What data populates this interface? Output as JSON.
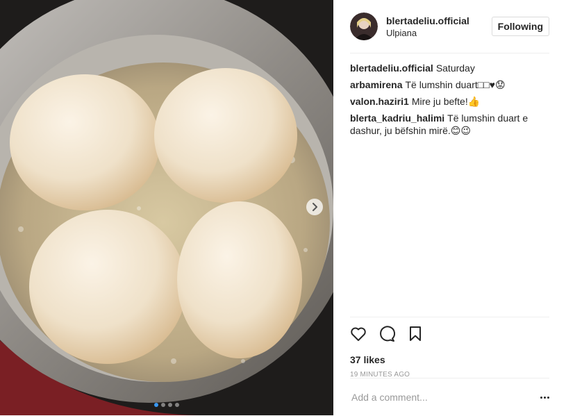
{
  "post": {
    "username": "blertadeliu.official",
    "location": "Ulpiana",
    "follow_label": "Following",
    "caption": "Saturday",
    "comments": [
      {
        "user": "arbamirena",
        "text": "Të lumshin duart□□♥😟"
      },
      {
        "user": "valon.haziri1",
        "text": "Mire ju befte!👍"
      },
      {
        "user": "blerta_kadriu_halimi",
        "text": "Të lumshin duart e dashur, ju bëfshin mirë.😊😉"
      }
    ],
    "likes": "37 likes",
    "time": "19 MINUTES AGO",
    "add_comment_placeholder": "Add a comment..."
  },
  "carousel": {
    "current": 1,
    "total": 4
  },
  "icons": {
    "like": "heart-outline-icon",
    "comment": "speech-bubble-icon",
    "save": "bookmark-icon",
    "next": "chevron-right-icon",
    "more": "three-dots-icon"
  },
  "colors": {
    "accent": "#3897f0",
    "text": "#262626",
    "muted": "#999999",
    "border": "#efefef"
  }
}
